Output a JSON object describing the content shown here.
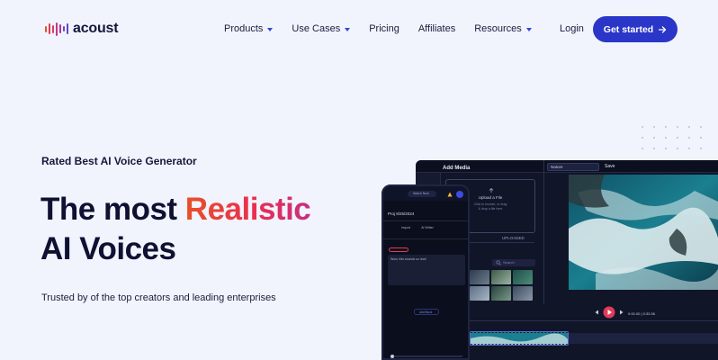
{
  "brand": {
    "name": "acoust"
  },
  "nav": {
    "items": [
      {
        "label": "Products",
        "has_dropdown": true
      },
      {
        "label": "Use Cases",
        "has_dropdown": true
      },
      {
        "label": "Pricing",
        "has_dropdown": false
      },
      {
        "label": "Affiliates",
        "has_dropdown": false
      },
      {
        "label": "Resources",
        "has_dropdown": true
      }
    ],
    "login": "Login",
    "cta": "Get started"
  },
  "hero": {
    "eyebrow": "Rated Best AI Voice Generator",
    "headline_prefix": "The most ",
    "headline_highlight": "Realistic",
    "headline_line2": "AI Voices",
    "subtext": "Trusted by of the top creators and leading enterprises"
  },
  "desktop_mock": {
    "panel_title": "Add Media",
    "upload_title": "Upload a File",
    "upload_hint_line1": "Click to browse, or drag",
    "upload_hint_line2": "& drop a file here",
    "tab_uploaded": "UPLOADED",
    "search_placeholder": "Search",
    "project_name": "Nature",
    "save_label": "Save",
    "timecode": "0:00.00 | 0:33.56"
  },
  "phone_mock": {
    "watch_label": "Watch Now",
    "project_title": "Proj 8/25/2024",
    "action_import": "Import",
    "action_writer": "AI Writer",
    "editor_text": "Wow, this sounds so real!",
    "add_label": "Add Block"
  },
  "colors": {
    "accent": "#2a36c7",
    "background": "#f1f4fc",
    "headline_gradient": [
      "#e8502a",
      "#ea2f4e",
      "#c72f83"
    ],
    "logo_bars": [
      "#e8502a",
      "#e63b4e",
      "#d93a6a",
      "#c3378a",
      "#a33aa0",
      "#7d41b6",
      "#5c4ac4"
    ]
  },
  "icons": {
    "cta_arrow": "arrow-right-icon",
    "dropdown": "caret-down-icon",
    "logo": "soundwave-icon"
  }
}
